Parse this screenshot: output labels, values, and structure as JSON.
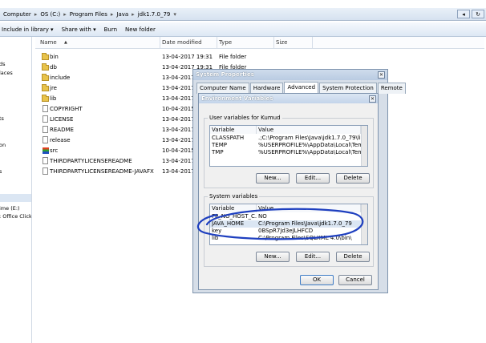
{
  "address": {
    "crumbs": [
      "Computer",
      "OS (C:)",
      "Program Files",
      "Java",
      "jdk1.7.0_79"
    ],
    "back_glyph": "◂",
    "refresh_glyph": "↻"
  },
  "toolbar": {
    "include": "Include in library ▾",
    "share": "Share with ▾",
    "burn": "Burn",
    "new_folder": "New folder"
  },
  "nav": {
    "items": [
      "ds",
      "laces",
      "ts",
      "on",
      "s",
      "ime (E:)",
      ": Office Click-t"
    ]
  },
  "columns": {
    "name": "Name",
    "date": "Date modified",
    "type": "Type",
    "size": "Size"
  },
  "files": [
    {
      "name": "bin",
      "date": "13-04-2017 19:31",
      "type": "File folder",
      "icon": "folder"
    },
    {
      "name": "db",
      "date": "13-04-2017 19:31",
      "type": "File folder",
      "icon": "folder"
    },
    {
      "name": "include",
      "date": "13-04-2017 1",
      "type": "",
      "icon": "folder"
    },
    {
      "name": "jre",
      "date": "13-04-2017 1",
      "type": "",
      "icon": "folder"
    },
    {
      "name": "lib",
      "date": "13-04-2017 1",
      "type": "",
      "icon": "folder"
    },
    {
      "name": "COPYRIGHT",
      "date": "10-04-2015 1",
      "type": "",
      "icon": "file"
    },
    {
      "name": "LICENSE",
      "date": "13-04-2017 1",
      "type": "",
      "icon": "file"
    },
    {
      "name": "README",
      "date": "13-04-2017 1",
      "type": "",
      "icon": "file"
    },
    {
      "name": "release",
      "date": "13-04-2017 1",
      "type": "",
      "icon": "file"
    },
    {
      "name": "src",
      "date": "10-04-2015 1",
      "type": "",
      "icon": "src"
    },
    {
      "name": "THIRDPARTYLICENSEREADME",
      "date": "13-04-2017 1",
      "type": "",
      "icon": "file"
    },
    {
      "name": "THIRDPARTYLICENSEREADME-JAVAFX",
      "date": "13-04-2017 1",
      "type": "",
      "icon": "file"
    }
  ],
  "system_properties": {
    "title": "System Properties",
    "close_glyph": "✕",
    "tabs": [
      "Computer Name",
      "Hardware",
      "Advanced",
      "System Protection",
      "Remote"
    ]
  },
  "env_vars": {
    "title": "Environment Variables",
    "close_glyph": "✕",
    "user_group": "User variables for Kumud",
    "user_headers": {
      "variable": "Variable",
      "value": "Value"
    },
    "user_rows": [
      {
        "variable": "CLASSPATH",
        "value": ".;C:\\Program Files\\Java\\jdk1.7.0_79\\lib..."
      },
      {
        "variable": "TEMP",
        "value": "%USERPROFILE%\\AppData\\Local\\Temp"
      },
      {
        "variable": "TMP",
        "value": "%USERPROFILE%\\AppData\\Local\\Temp"
      }
    ],
    "system_group": "System variables",
    "system_headers": {
      "variable": "Variable",
      "value": "Value"
    },
    "system_rows": [
      {
        "variable": "FP_NO_HOST_C...",
        "value": "NO"
      },
      {
        "variable": "JAVA_HOME",
        "value": "C:\\Program Files\\Java\\jdk1.7.0_79"
      },
      {
        "variable": "key",
        "value": "0BSpR7Jd3eJLHFCD"
      },
      {
        "variable": "lib",
        "value": "C:\\Program Files\\SQLXML 4.0\\bin\\"
      }
    ],
    "btn_new": "New...",
    "btn_edit": "Edit...",
    "btn_delete": "Delete",
    "btn_ok": "OK",
    "btn_cancel": "Cancel"
  },
  "colors": {
    "annotation": "#1e3fbf",
    "selection": "#dbe6f3"
  }
}
